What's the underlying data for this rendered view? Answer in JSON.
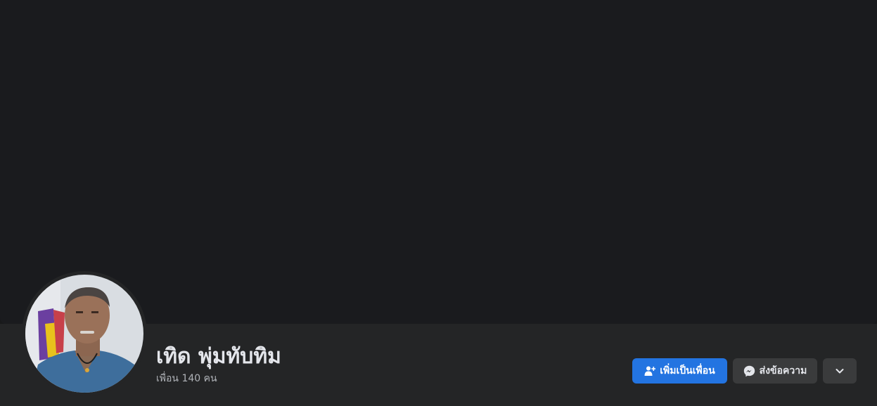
{
  "profile": {
    "name": "เทิด พุ่มทับทิม",
    "friends_count": "เพื่อน 140 คน"
  },
  "actions": {
    "add_friend_label": "เพิ่มเป็นเพื่อน",
    "message_label": "ส่งข้อความ"
  },
  "icons": {
    "add_friend": "add-friend-icon",
    "messenger": "messenger-icon",
    "more": "chevron-down-icon"
  },
  "colors": {
    "primary_button": "#2374e1",
    "secondary_button": "#3a3b3c",
    "surface": "#242526",
    "cover": "#1a1b1e"
  }
}
